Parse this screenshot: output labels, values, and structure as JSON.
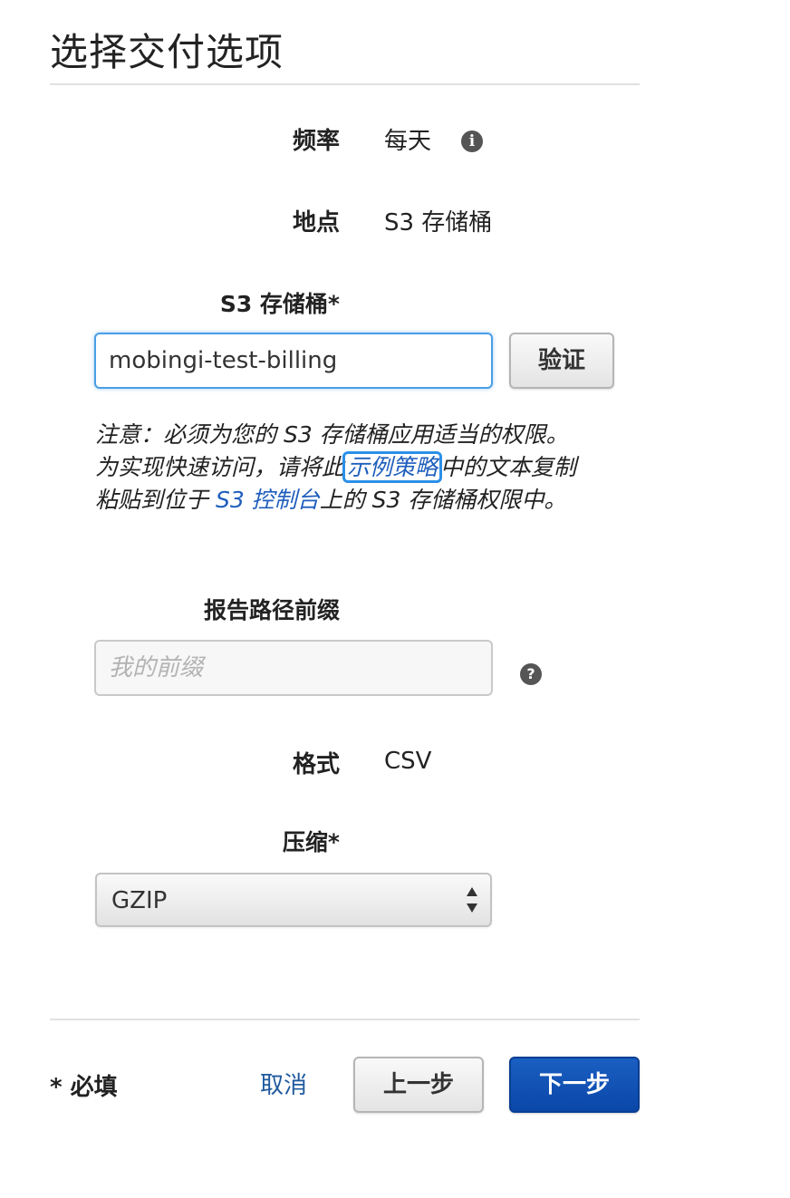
{
  "page": {
    "title": "选择交付选项"
  },
  "frequency": {
    "label": "频率",
    "value": "每天",
    "icon": "info-icon"
  },
  "location": {
    "label": "地点",
    "value": "S3 存储桶"
  },
  "s3_bucket": {
    "label": "S3 存储桶*",
    "value": "mobingi-test-billing",
    "verify_button": "验证"
  },
  "note": {
    "part1": "注意：必须为您的 S3 存储桶应用适当的权限。为实现快速访问，请将此",
    "link1": "示例策略",
    "part2": "中的文本复制粘贴到位于 ",
    "link2": "S3 控制台",
    "part3": "上的 S3 存储桶权限中。"
  },
  "report_prefix": {
    "label": "报告路径前缀",
    "placeholder": "我的前缀",
    "value": "",
    "icon": "help-icon"
  },
  "format": {
    "label": "格式",
    "value": "CSV"
  },
  "compression": {
    "label": "压缩*",
    "selected": "GZIP"
  },
  "footer": {
    "required": "* 必填",
    "cancel": "取消",
    "previous": "上一步",
    "next": "下一步"
  },
  "colors": {
    "primary_button": "#0a47a8",
    "link": "#1f5ebd",
    "focus_border": "#4a9ee6"
  }
}
